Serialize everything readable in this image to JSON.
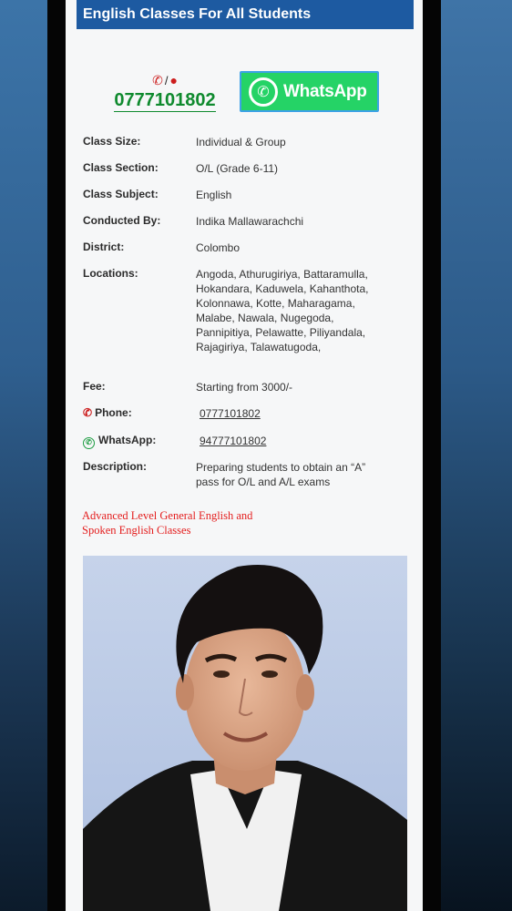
{
  "header": {
    "title": "English Classes For All Students"
  },
  "contact": {
    "phone_big": "0777101802",
    "whatsapp_button": "WhatsApp"
  },
  "details": {
    "class_size": {
      "label": "Class Size:",
      "value": "Individual & Group"
    },
    "class_section": {
      "label": "Class Section:",
      "value": "O/L (Grade 6-11)"
    },
    "class_subject": {
      "label": "Class Subject:",
      "value": "English"
    },
    "conducted_by": {
      "label": "Conducted By:",
      "value": "Indika Mallawarachchi"
    },
    "district": {
      "label": "District:",
      "value": "Colombo"
    },
    "locations": {
      "label": "Locations:",
      "lines": [
        "Angoda, Athurugiriya, Battaramulla,",
        "Hokandara, Kaduwela, Kahanthota,",
        "Kolonnawa, Kotte, Maharagama,",
        "Malabe, Nawala, Nugegoda,",
        "Pannipitiya, Pelawatte, Piliyandala,",
        "Rajagiriya, Talawatugoda,"
      ]
    },
    "fee": {
      "label": "Fee:",
      "value": "Starting from 3000/-"
    },
    "phone": {
      "label": "Phone:",
      "value": "0777101802"
    },
    "whatsapp": {
      "label": "WhatsApp:",
      "value": "94777101802"
    },
    "description": {
      "label": "Description:",
      "lines": [
        "Preparing students to obtain an “A”",
        "pass for O/L and A/L exams"
      ]
    }
  },
  "subtitle": {
    "lines": [
      "Advanced Level General English and",
      "Spoken English Classes"
    ]
  },
  "colors": {
    "header_bg": "#1d5aa1",
    "phone_green": "#0f8a2e",
    "whatsapp_green": "#25d366",
    "accent_red": "#e41e1e"
  }
}
